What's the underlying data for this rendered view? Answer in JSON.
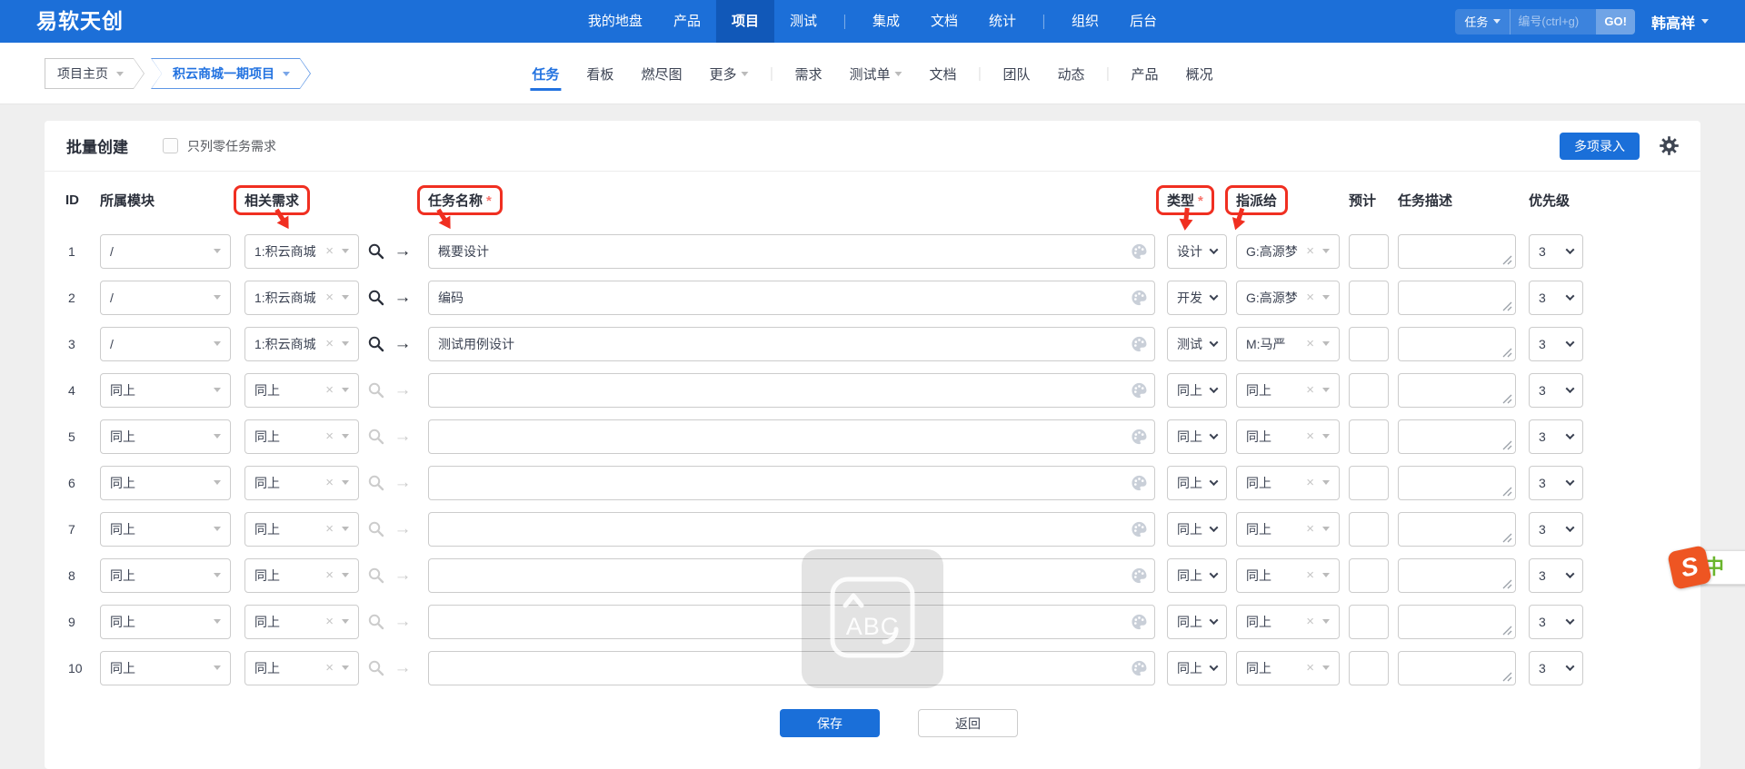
{
  "navbar": {
    "logo": "易软天创",
    "menu": [
      {
        "key": "my",
        "label": "我的地盘"
      },
      {
        "key": "product",
        "label": "产品"
      },
      {
        "key": "project",
        "label": "项目",
        "active": true
      },
      {
        "key": "qa",
        "label": "测试"
      },
      {
        "divider": true
      },
      {
        "key": "integration",
        "label": "集成"
      },
      {
        "key": "doc",
        "label": "文档"
      },
      {
        "key": "report",
        "label": "统计"
      },
      {
        "divider": true
      },
      {
        "key": "org",
        "label": "组织"
      },
      {
        "key": "admin",
        "label": "后台"
      }
    ],
    "search": {
      "type_label": "任务",
      "placeholder": "编号(ctrl+g)",
      "go_label": "GO!"
    },
    "user": "韩高祥"
  },
  "breadcrumb": {
    "home": "项目主页",
    "project": "积云商城一期项目"
  },
  "tabs": [
    {
      "key": "task",
      "label": "任务",
      "active": true
    },
    {
      "key": "kanban",
      "label": "看板"
    },
    {
      "key": "burn",
      "label": "燃尽图"
    },
    {
      "key": "more",
      "label": "更多",
      "caret": true
    },
    {
      "divider": true
    },
    {
      "key": "story",
      "label": "需求"
    },
    {
      "key": "testtask",
      "label": "测试单",
      "caret": true
    },
    {
      "key": "doc",
      "label": "文档"
    },
    {
      "divider": true
    },
    {
      "key": "team",
      "label": "团队"
    },
    {
      "key": "dynamic",
      "label": "动态"
    },
    {
      "divider": true
    },
    {
      "key": "product",
      "label": "产品"
    },
    {
      "key": "overview",
      "label": "概况"
    }
  ],
  "panel": {
    "title": "批量创建",
    "filter_label": "只列零任务需求",
    "multi_entry_label": "多项录入"
  },
  "table": {
    "headers": {
      "id": "ID",
      "module": "所属模块",
      "story": "相关需求",
      "name": "任务名称",
      "type": "类型",
      "assign": "指派给",
      "estimate": "预计",
      "desc": "任务描述",
      "priority": "优先级"
    },
    "required_mark": "*",
    "rows": [
      {
        "id": "1",
        "module": "/",
        "story": "1:积云商城",
        "name": "概要设计",
        "type": "设计",
        "assign": "G:高源梦",
        "estimate": "",
        "desc": "",
        "priority": "3",
        "active": true
      },
      {
        "id": "2",
        "module": "/",
        "story": "1:积云商城",
        "name": "编码",
        "type": "开发",
        "assign": "G:高源梦",
        "estimate": "",
        "desc": "",
        "priority": "3",
        "active": true
      },
      {
        "id": "3",
        "module": "/",
        "story": "1:积云商城",
        "name": "测试用例设计",
        "type": "测试",
        "assign": "M:马严",
        "estimate": "",
        "desc": "",
        "priority": "3",
        "active": true
      },
      {
        "id": "4",
        "module": "同上",
        "story": "同上",
        "name": "",
        "type": "同上",
        "assign": "同上",
        "estimate": "",
        "desc": "",
        "priority": "3",
        "active": false
      },
      {
        "id": "5",
        "module": "同上",
        "story": "同上",
        "name": "",
        "type": "同上",
        "assign": "同上",
        "estimate": "",
        "desc": "",
        "priority": "3",
        "active": false
      },
      {
        "id": "6",
        "module": "同上",
        "story": "同上",
        "name": "",
        "type": "同上",
        "assign": "同上",
        "estimate": "",
        "desc": "",
        "priority": "3",
        "active": false
      },
      {
        "id": "7",
        "module": "同上",
        "story": "同上",
        "name": "",
        "type": "同上",
        "assign": "同上",
        "estimate": "",
        "desc": "",
        "priority": "3",
        "active": false
      },
      {
        "id": "8",
        "module": "同上",
        "story": "同上",
        "name": "",
        "type": "同上",
        "assign": "同上",
        "estimate": "",
        "desc": "",
        "priority": "3",
        "active": false
      },
      {
        "id": "9",
        "module": "同上",
        "story": "同上",
        "name": "",
        "type": "同上",
        "assign": "同上",
        "estimate": "",
        "desc": "",
        "priority": "3",
        "active": false
      },
      {
        "id": "10",
        "module": "同上",
        "story": "同上",
        "name": "",
        "type": "同上",
        "assign": "同上",
        "estimate": "",
        "desc": "",
        "priority": "3",
        "active": false
      }
    ]
  },
  "footer": {
    "save_label": "保存",
    "back_label": "返回"
  },
  "overlays": {
    "ime_label": "ABC",
    "sogou_letter": "S",
    "sogou_mode": "中"
  },
  "colors": {
    "navbar": "#1c6fd8",
    "nav_active": "#1158b8",
    "accent": "#2272e0",
    "primary_button": "#1a6fd9",
    "annotation_red": "#f02f21"
  }
}
